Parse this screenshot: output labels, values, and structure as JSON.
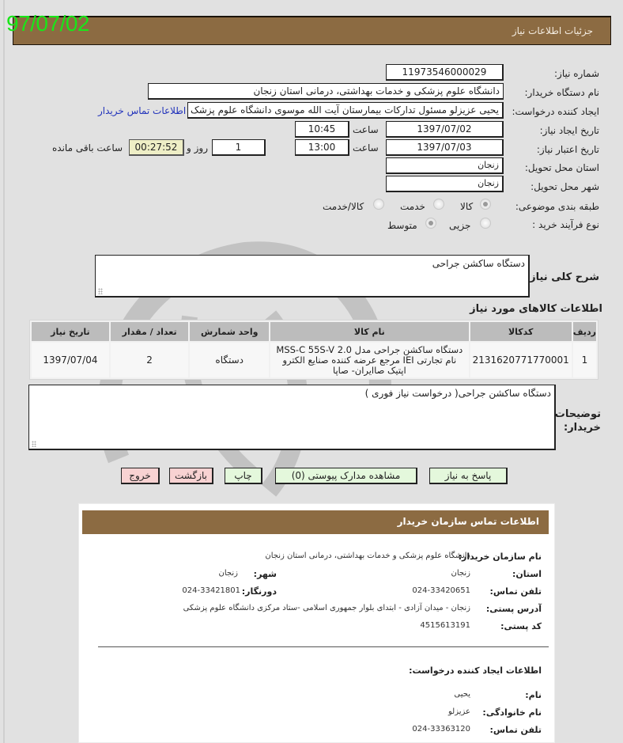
{
  "stamp_date": "97/07/02",
  "header": {
    "title": "جزئیات اطلاعات نیاز"
  },
  "form": {
    "need_number": {
      "label": "شماره نیاز:",
      "value": "11973546000029"
    },
    "buyer_org": {
      "label": "نام دستگاه خریدار:",
      "value": "دانشگاه علوم پزشکی و خدمات بهداشتی، درمانی استان زنجان"
    },
    "requester": {
      "label": "ایجاد کننده درخواست:",
      "value": "یحیی عزیزلو مسئول تدارکات بیمارستان آیت الله موسوی دانشگاه علوم پزشک",
      "contact_link": "اطلاعات تماس خریدار"
    },
    "created": {
      "label": "تاریخ ایجاد نیاز:",
      "date": "1397/07/02",
      "time_label": "ساعت",
      "time": "10:45"
    },
    "valid": {
      "label": "تاریخ اعتبار نیاز:",
      "date": "1397/07/03",
      "time_label": "ساعت",
      "time": "13:00",
      "days": "1",
      "days_label": "روز و",
      "remaining": "00:27:52",
      "remaining_label": "ساعت باقی مانده"
    },
    "delivery_province": {
      "label": "استان محل تحویل:",
      "value": "زنجان"
    },
    "delivery_city": {
      "label": "شهر محل تحویل:",
      "value": "زنجان"
    },
    "category": {
      "label": "طبقه بندی موضوعی:",
      "options": [
        "کالا",
        "خدمت",
        "کالا/خدمت"
      ],
      "selected": "کالا"
    },
    "purchase_type": {
      "label": "نوع فرآیند خرید :",
      "options": [
        "جزیی",
        "متوسط"
      ],
      "selected": "متوسط"
    }
  },
  "description": {
    "label": "شرح کلی نیاز:",
    "value": "دستگاه ساکشن جراحی"
  },
  "items_section": {
    "title": "اطلاعات کالاهای مورد نیاز",
    "columns": [
      "ردیف",
      "کدکالا",
      "نام کالا",
      "واحد شمارش",
      "تعداد / مقدار",
      "تاریخ نیاز"
    ],
    "rows": [
      {
        "row": "1",
        "code": "2131620771770001",
        "name": "دستگاه ساکشن جراحی مدل MSS-C 55S-V 2.0 نام تجارتی IEI مرجع عرضه کننده صنایع الکترو اپتیک صاایران- صاپا",
        "unit": "دستگاه",
        "qty": "2",
        "date": "1397/07/04"
      }
    ]
  },
  "buyer_notes": {
    "label": "توضیحات خریدار:",
    "value": "دستگاه ساکشن جراحی( درخواست نیاز فوری )"
  },
  "buttons": {
    "respond": "پاسخ به نیاز",
    "attachments": "مشاهده مدارک پیوستی (0)",
    "print": "چاپ",
    "back": "بازگشت",
    "exit": "خروج"
  },
  "contact_panel": {
    "title": "اطلاعات تماس سازمان خریدار",
    "org_label": "نام سازمان خریدار:",
    "org_value": "دانشگاه علوم پزشکی و خدمات بهداشتی، درمانی استان زنجان",
    "province_label": "استان:",
    "province_value": "زنجان",
    "city_label": "شهر:",
    "city_value": "زنجان",
    "phone_label": "تلفن تماس:",
    "phone_value": "024-33420651",
    "fax_label": "دورنگار:",
    "fax_value": "024-33421801",
    "address_label": "آدرس پستی:",
    "address_value": "زنجان - میدان آزادی - ابتدای بلوار جمهوری اسلامی -ستاد مرکزی دانشگاه علوم پزشکی",
    "postal_label": "کد پستی:",
    "postal_value": "4515613191",
    "creator_title": "اطلاعات ایجاد کننده درخواست:",
    "first_name_label": "نام:",
    "first_name_value": "یحیی",
    "last_name_label": "نام خانوادگی:",
    "last_name_value": "عزیزلو",
    "creator_phone_label": "تلفن تماس:",
    "creator_phone_value": "024-33363120"
  }
}
